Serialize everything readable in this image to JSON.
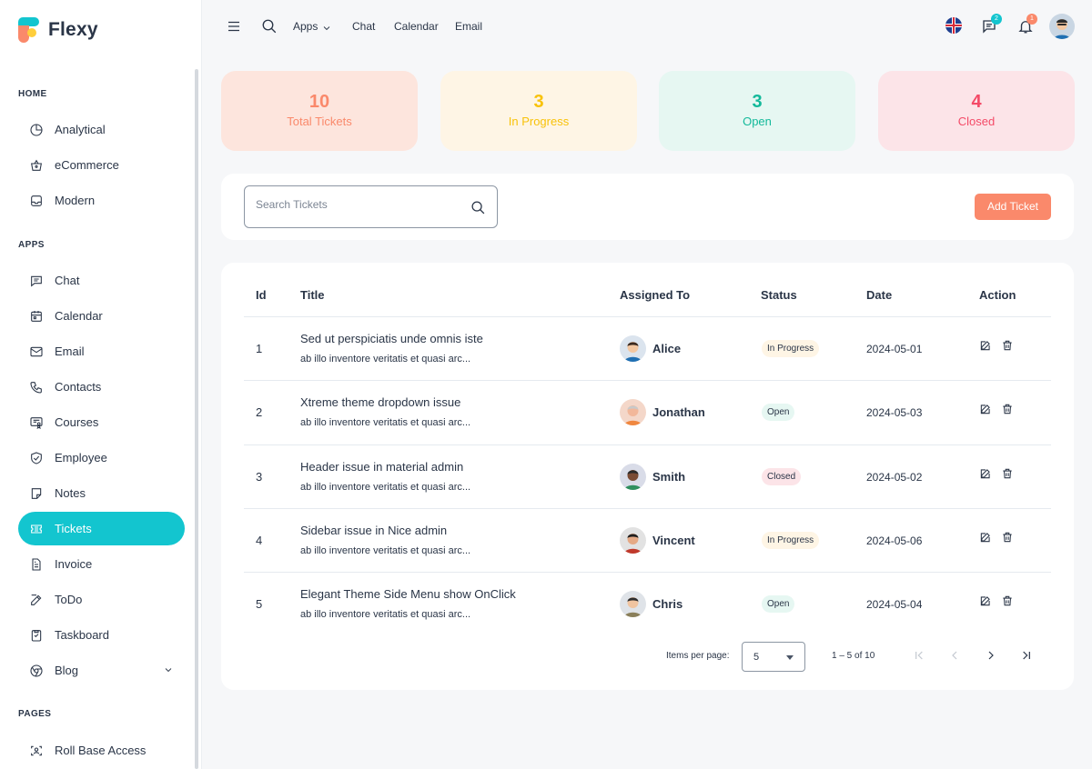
{
  "app": {
    "name": "Flexy"
  },
  "sidebar": {
    "sections": [
      {
        "title": "HOME",
        "items": [
          "Analytical",
          "eCommerce",
          "Modern"
        ]
      },
      {
        "title": "APPS",
        "items": [
          "Chat",
          "Calendar",
          "Email",
          "Contacts",
          "Courses",
          "Employee",
          "Notes",
          "Tickets",
          "Invoice",
          "ToDo",
          "Taskboard",
          "Blog"
        ]
      },
      {
        "title": "PAGES",
        "items": [
          "Roll Base Access"
        ]
      }
    ],
    "active_item": "Tickets",
    "icons": {
      "Analytical": "pie-chart-icon",
      "eCommerce": "basket-icon",
      "Modern": "inbox-icon",
      "Chat": "message-icon",
      "Calendar": "calendar-icon",
      "Email": "mail-icon",
      "Contacts": "phone-icon",
      "Courses": "certificate-icon",
      "Employee": "shield-icon",
      "Notes": "note-icon",
      "Tickets": "ticket-icon",
      "Invoice": "file-text-icon",
      "ToDo": "edit-icon",
      "Taskboard": "clipboard-icon",
      "Blog": "chrome-icon",
      "Roll Base Access": "face-id-icon"
    }
  },
  "topbar": {
    "links": [
      "Apps",
      "Chat",
      "Calendar",
      "Email"
    ],
    "messages_badge": "2",
    "notifications_badge": "1"
  },
  "stats": [
    {
      "value": "10",
      "label": "Total Tickets",
      "bg": "#fde5dd",
      "fg": "#fa896b"
    },
    {
      "value": "3",
      "label": "In Progress",
      "bg": "#fef5e5",
      "fg": "#f8c20a"
    },
    {
      "value": "3",
      "label": "Open",
      "bg": "#e6f7f2",
      "fg": "#13b99a"
    },
    {
      "value": "4",
      "label": "Closed",
      "bg": "#fce4e8",
      "fg": "#f44a67"
    }
  ],
  "search": {
    "placeholder": "Search Tickets",
    "value": ""
  },
  "add_button": "Add Ticket",
  "table": {
    "headers": [
      "Id",
      "Title",
      "Assigned To",
      "Status",
      "Date",
      "Action"
    ],
    "rows": [
      {
        "id": "1",
        "title": "Sed ut perspiciatis unde omnis iste",
        "desc": "ab illo inventore veritatis et quasi arc...",
        "assignee": "Alice",
        "status": "In Progress",
        "date": "2024-05-01"
      },
      {
        "id": "2",
        "title": "Xtreme theme dropdown issue",
        "desc": "ab illo inventore veritatis et quasi arc...",
        "assignee": "Jonathan",
        "status": "Open",
        "date": "2024-05-03"
      },
      {
        "id": "3",
        "title": "Header issue in material admin",
        "desc": "ab illo inventore veritatis et quasi arc...",
        "assignee": "Smith",
        "status": "Closed",
        "date": "2024-05-02"
      },
      {
        "id": "4",
        "title": "Sidebar issue in Nice admin",
        "desc": "ab illo inventore veritatis et quasi arc...",
        "assignee": "Vincent",
        "status": "In Progress",
        "date": "2024-05-06"
      },
      {
        "id": "5",
        "title": "Elegant Theme Side Menu show OnClick",
        "desc": "ab illo inventore veritatis et quasi arc...",
        "assignee": "Chris",
        "status": "Open",
        "date": "2024-05-04"
      }
    ]
  },
  "status_colors": {
    "In Progress": {
      "bg": "#fef5e5",
      "fg": "#2a3547"
    },
    "Open": {
      "bg": "#e6f7f2",
      "fg": "#2a3547"
    },
    "Closed": {
      "bg": "#fce4e8",
      "fg": "#2a3547"
    }
  },
  "pagination": {
    "items_per_page_label": "Items per page:",
    "items_per_page": "5",
    "range": "1 – 5 of 10"
  }
}
